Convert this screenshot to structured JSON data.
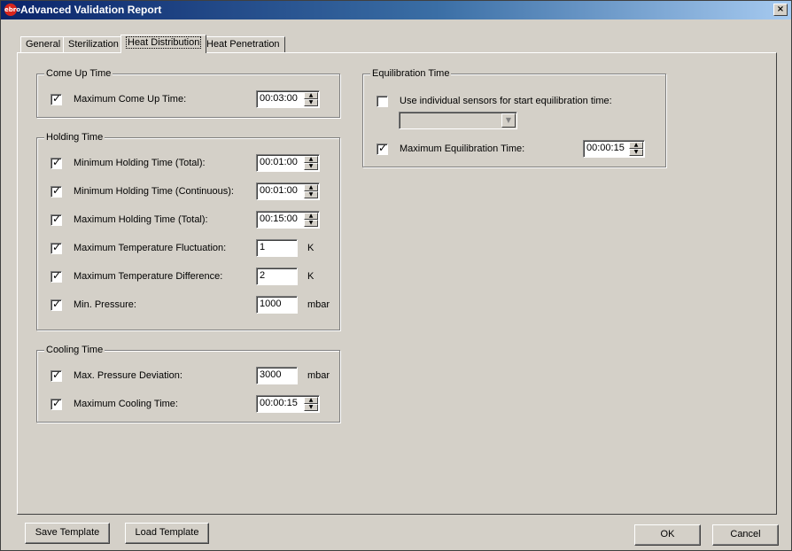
{
  "window": {
    "title": "Advanced Validation Report",
    "close_glyph": "×",
    "app_icon_text": "ebro"
  },
  "tabs": [
    {
      "label": "General"
    },
    {
      "label": "Sterilization"
    },
    {
      "label": "Heat Distribution"
    },
    {
      "label": "Heat Penetration"
    }
  ],
  "come_up": {
    "title": "Come Up Time",
    "max_come_up": {
      "label": "Maximum Come Up Time:",
      "checked": true,
      "value": "00:03:00"
    }
  },
  "holding": {
    "title": "Holding Time",
    "min_total": {
      "label": "Minimum Holding Time (Total):",
      "value": "00:01:00"
    },
    "min_cont": {
      "label": "Minimum Holding Time (Continuous):",
      "value": "00:01:00"
    },
    "max_total": {
      "label": "Maximum Holding Time (Total):",
      "value": "00:15:00"
    },
    "max_fluct": {
      "label": "Maximum Temperature Fluctuation:",
      "value": "1",
      "unit": "K"
    },
    "max_diff": {
      "label": "Maximum Temperature Difference:",
      "value": "2",
      "unit": "K"
    },
    "min_pressure": {
      "label": "Min. Pressure:",
      "value": "1000",
      "unit": "mbar"
    }
  },
  "cooling": {
    "title": "Cooling Time",
    "max_pdev": {
      "label": "Max. Pressure Deviation:",
      "value": "3000",
      "unit": "mbar"
    },
    "max_cool": {
      "label": "Maximum Cooling Time:",
      "value": "00:00:15"
    }
  },
  "equilibration": {
    "title": "Equilibration Time",
    "use_individual": {
      "label": "Use individual sensors for start equilibration time:",
      "checked": false
    },
    "sensor_select": {
      "value": ""
    },
    "max_eq": {
      "label": "Maximum Equilibration Time:",
      "checked": true,
      "value": "00:00:15"
    }
  },
  "buttons": {
    "save_template": "Save Template",
    "load_template": "Load Template",
    "ok": "OK",
    "cancel": "Cancel"
  },
  "glyphs": {
    "check": "✓",
    "up": "▲",
    "down": "▼"
  },
  "colors": {
    "face": "#d4d0c8",
    "title_start": "#0a246a",
    "title_end": "#a6caf0",
    "icon": "#d9251c"
  }
}
